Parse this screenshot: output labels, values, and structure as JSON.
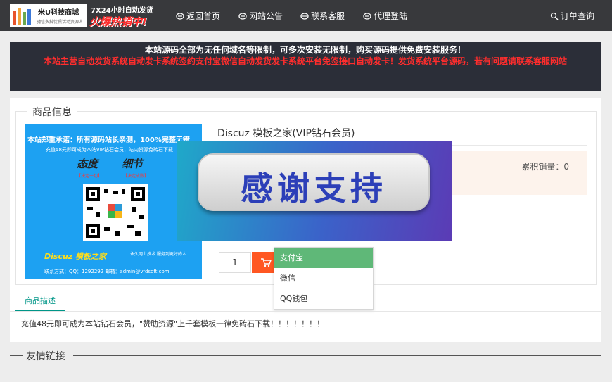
{
  "header": {
    "logo_name": "米U科技商城",
    "logo_sub": "驰信多抖优质活动资源人",
    "promo_line1": "7X24小时自动发货",
    "promo_line2": "火爆热销中!",
    "nav": [
      {
        "label": "返回首页",
        "icon": "home-icon"
      },
      {
        "label": "网站公告",
        "icon": "announcement-icon"
      },
      {
        "label": "联系客服",
        "icon": "service-icon"
      },
      {
        "label": "代理登陆",
        "icon": "agent-icon"
      }
    ],
    "order_query": "订单查询"
  },
  "notice": {
    "line1": "本站源码全部为无任何域名等限制，可多次安装无限制，购买源码提供免费安装服务！",
    "line2": "本站主营自动发货系统自动发卡系统签约支付宝微信自动发货发卡系统平台免签接口自动发卡！发货系统平台源码，若有问题请联系客服网站"
  },
  "product": {
    "section_title": "商品信息",
    "image": {
      "line1": "本站郑重承诺：所有源码站长亲测，100%完整无错",
      "line2": "充值48元即可成为本站VIP钻石会员，站内资源免砖石下载",
      "callig1": "态度",
      "callig2": "细节",
      "badge1": "【决定一切】",
      "badge2": "【决定成败】",
      "bottom_brand": "Discuz 模板之家",
      "bottom_note": "永久网上技术 服务到更好的人",
      "contact": "联系方式：QQ：1292292  邮箱：admin@vfdsoft.com"
    },
    "title": "Discuz 模板之家(VIP钻石会员)",
    "sales": "累积销量：",
    "sales_count": "0",
    "quantity": "1",
    "payment_options": [
      {
        "label": "支付宝",
        "selected": true
      },
      {
        "label": "微信",
        "selected": false
      },
      {
        "label": "QQ钱包",
        "selected": false
      }
    ],
    "overlay_text": "感谢支持"
  },
  "tabs": {
    "active": "商品描述"
  },
  "description": "充值48元即可成为本站钻石会员，\"赞助资源\"上千套模板一律免砖石下载！！！！！！！",
  "footer": {
    "friend_links": "友情链接"
  },
  "colors": {
    "topbar": "#38393c",
    "accent": "#009688",
    "buy": "#ff5722",
    "selected_option": "#5fb878",
    "notice_red": "#ff2d2d"
  }
}
